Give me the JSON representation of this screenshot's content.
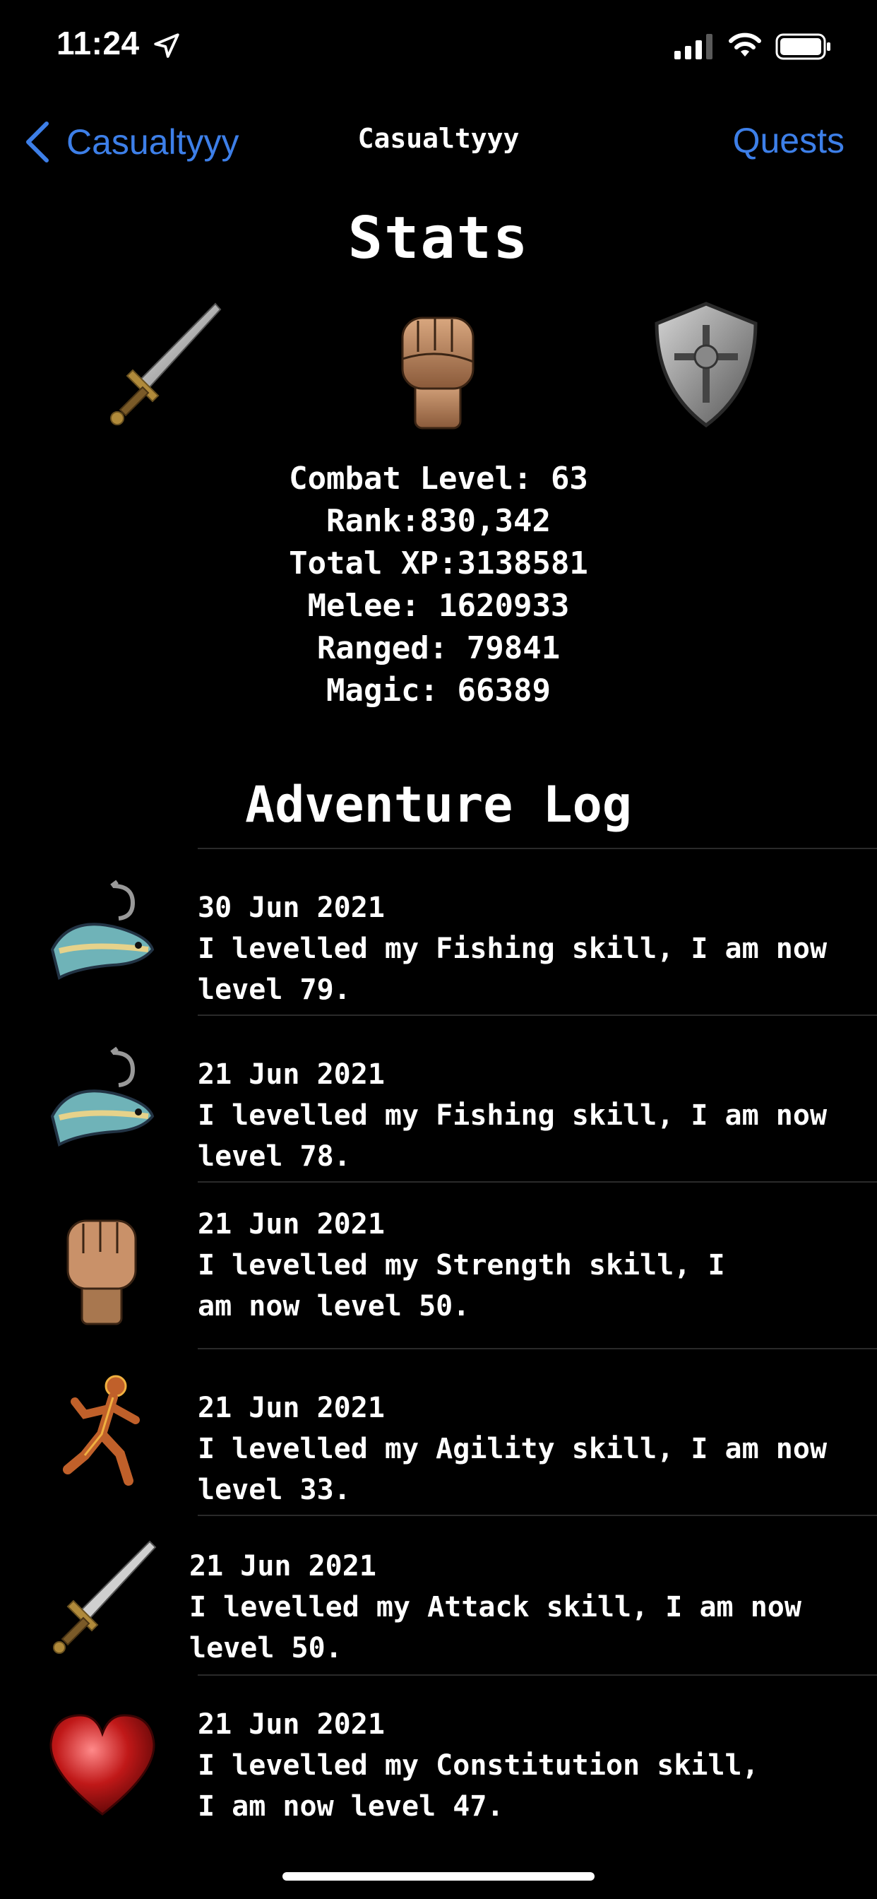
{
  "status": {
    "time": "11:24"
  },
  "nav": {
    "back_label": "Casualtyyy",
    "title": "Casualtyyy",
    "right_label": "Quests"
  },
  "stats": {
    "title": "Stats",
    "lines": [
      "Combat Level: 63",
      "Rank:830,342",
      "Total XP:3138581",
      "Melee: 1620933",
      "Ranged: 79841",
      "Magic: 66389"
    ],
    "icons": [
      "sword-icon",
      "fist-icon",
      "shield-icon"
    ]
  },
  "adventure_log": {
    "title": "Adventure Log",
    "entries": [
      {
        "icon": "fishing-icon",
        "date": "30 Jun 2021",
        "text": "I levelled my Fishing skill, I am now level 79."
      },
      {
        "icon": "fishing-icon",
        "date": "21 Jun 2021",
        "text": "I levelled my Fishing skill, I am now level 78."
      },
      {
        "icon": "fist-icon",
        "date": "21 Jun 2021",
        "text": "I levelled my Strength skill, I am now level 50."
      },
      {
        "icon": "agility-runner-icon",
        "date": "21 Jun 2021",
        "text": "I levelled my Agility skill, I am now level 33."
      },
      {
        "icon": "sword-icon",
        "date": "21 Jun 2021",
        "text": "I levelled my Attack skill, I am now level 50."
      },
      {
        "icon": "heart-icon",
        "date": "21 Jun 2021",
        "text": "I levelled my Constitution skill, I am now level 47."
      }
    ]
  },
  "colors": {
    "background": "#000000",
    "link": "#3d7fe8",
    "text": "#ffffff"
  }
}
